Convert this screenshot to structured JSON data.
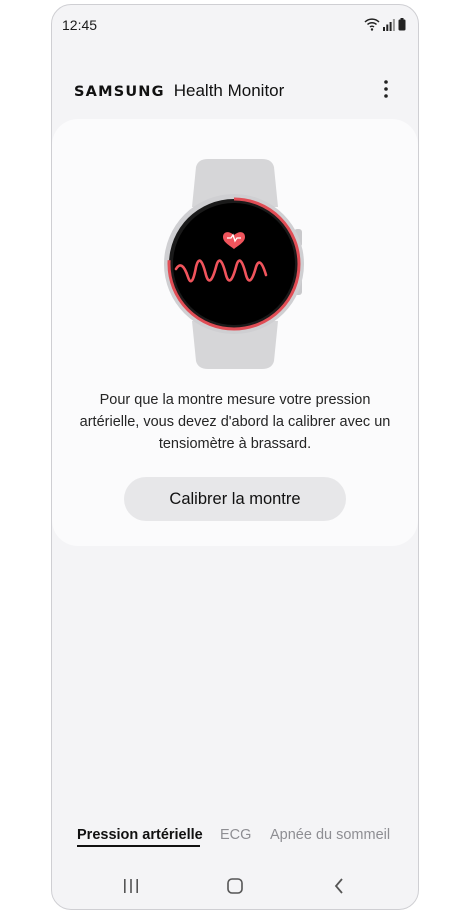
{
  "status_bar": {
    "time": "12:45",
    "icons": [
      "wifi-icon",
      "signal-icon",
      "battery-icon"
    ]
  },
  "app_bar": {
    "brand": "SAMSUNG",
    "product": "Health Monitor",
    "menu_icon": "more-vert-icon"
  },
  "card": {
    "illustration": "smartwatch-heart-rate-icon",
    "description": "Pour que la montre mesure votre pression artérielle, vous devez d'abord la calibrer avec un tensiomètre à brassard.",
    "button_label": "Calibrer la montre"
  },
  "tabs": [
    {
      "label": "Pression artérielle",
      "active": true
    },
    {
      "label": "ECG",
      "active": false
    },
    {
      "label": "Apnée du sommeil",
      "active": false
    }
  ],
  "nav_bar": {
    "recents_icon": "recents-icon",
    "home_icon": "home-icon",
    "back_icon": "back-icon"
  },
  "colors": {
    "accent_red": "#f0545c",
    "watch_gray": "#d6d6d8",
    "background": "#f4f4f6",
    "card": "#fbfbfc"
  }
}
